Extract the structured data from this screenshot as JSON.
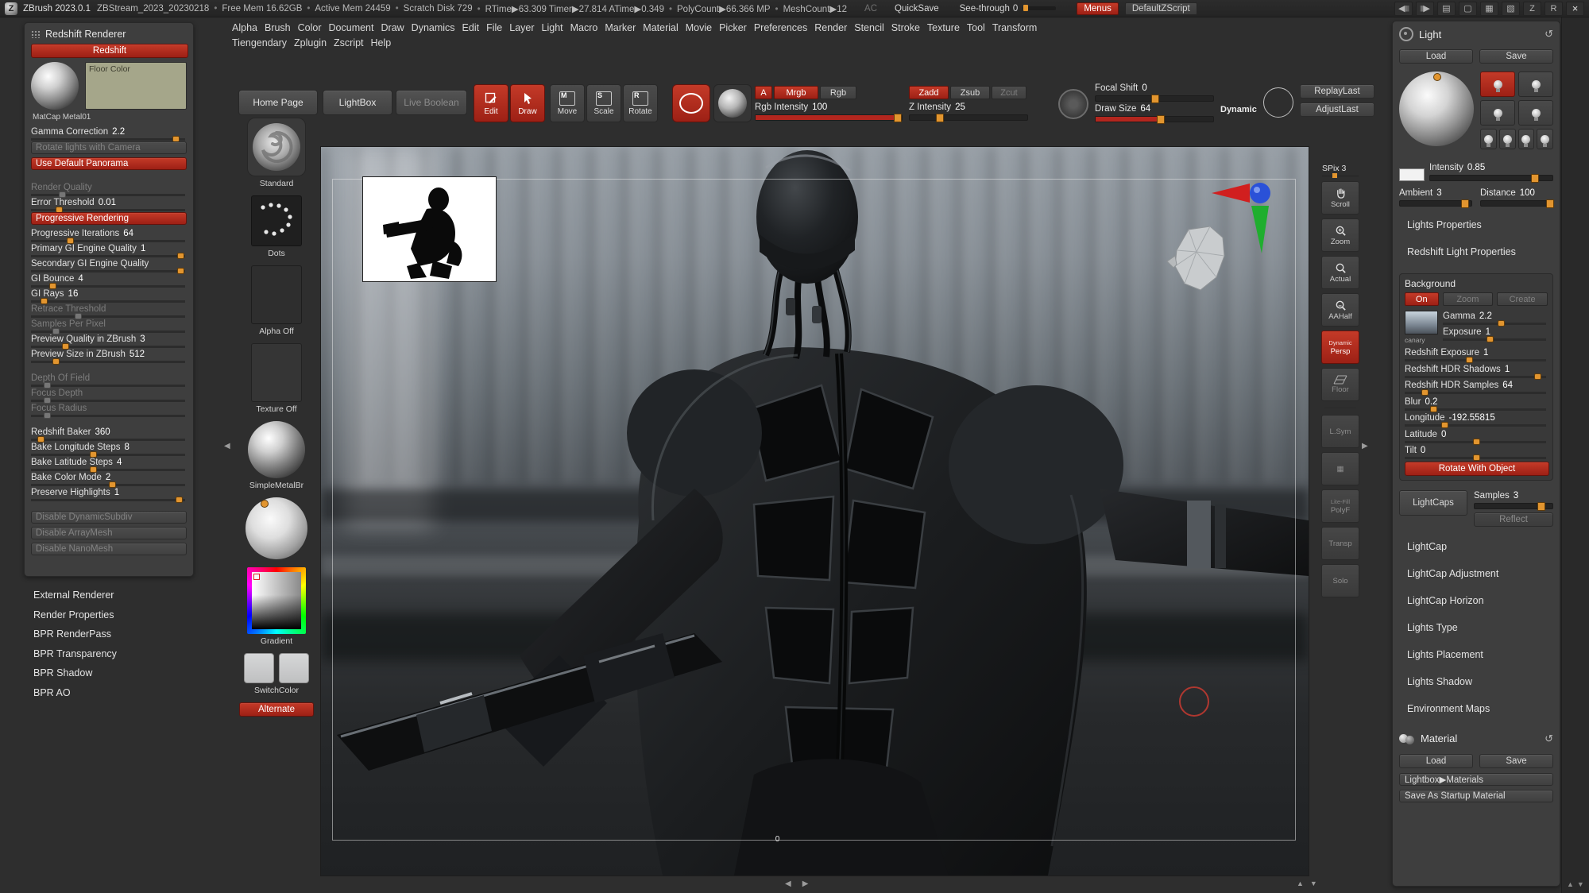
{
  "colors": {
    "accent_red": "#b3261e",
    "accent_orange": "#e2952f",
    "panel_bg": "#3e3e3e",
    "titlebar_bg": "#262626",
    "floor_color": "#a5a68a"
  },
  "icons": {
    "z_logo": "Z",
    "r_logo": "R",
    "close": "×",
    "scroll_left": "◀",
    "scroll_right": "▶",
    "bars": "||||",
    "tablet": "▤",
    "monitor": "▢",
    "grid": "▦",
    "doc": "▧",
    "refresh": "↺",
    "up": "▲",
    "down": "▼"
  },
  "titlebar": {
    "app_title": "ZBrush 2023.0.1",
    "stream": "ZBStream_2023_20230218",
    "stats": [
      "Free Mem 16.62GB",
      "Active Mem 24459",
      "Scratch Disk 729",
      "RTime▶63.309  Timer▶27.814  ATime▶0.349",
      "PolyCount▶66.366 MP",
      "MeshCount▶12"
    ],
    "ac": "AC",
    "quicksave": "QuickSave",
    "see_through": {
      "label": "See-through",
      "value": "0",
      "dot": 8
    },
    "menus": "Menus",
    "default_zscript": "DefaultZScript"
  },
  "menubar": {
    "row1": [
      "Alpha",
      "Brush",
      "Color",
      "Document",
      "Draw",
      "Dynamics",
      "Edit",
      "File",
      "Layer",
      "Light",
      "Macro",
      "Marker",
      "Material",
      "Movie",
      "Picker",
      "Preferences",
      "Render",
      "Stencil",
      "Stroke",
      "Texture",
      "Tool",
      "Transform"
    ],
    "row2": [
      "Tiengendary",
      "Zplugin",
      "Zscript",
      "Help"
    ]
  },
  "toolbar": {
    "home_page": "Home Page",
    "lightbox": "LightBox",
    "live_boolean": "Live Boolean",
    "edit": "Edit",
    "draw": "Draw",
    "move": "Move",
    "scale": "Scale",
    "rotate": "Rotate",
    "badges": {
      "move": "M",
      "scale": "S",
      "rotate": "R"
    },
    "paint_a": "A",
    "paint_mrgb": "Mrgb",
    "paint_rgb": "Rgb",
    "rgb_intensity": {
      "label": "Rgb Intensity",
      "value": "100",
      "fill": 100,
      "dot": 97
    },
    "zadd": "Zadd",
    "zsub": "Zsub",
    "zcut": "Zcut",
    "z_intensity": {
      "label": "Z Intensity",
      "value": "25",
      "fill": 0,
      "dot": 25
    },
    "focal_shift": {
      "label": "Focal Shift",
      "value": "0",
      "fill": 0,
      "dot": 50
    },
    "draw_size": {
      "label": "Draw Size",
      "value": "64",
      "fill": 55,
      "dot": 55
    },
    "dynamic": "Dynamic",
    "replay_last": "ReplayLast",
    "adjust_last": "AdjustLast"
  },
  "left_panel": {
    "title": "Redshift Renderer",
    "redshift_button": "Redshift",
    "matcap_label": "MatCap Metal01",
    "floor_color_label": "Floor Color",
    "items": [
      {
        "t": "slider",
        "label": "Gamma Correction",
        "value": "2.2",
        "dot": 93
      },
      {
        "t": "button",
        "label": "Rotate lights with Camera",
        "state": "dim"
      },
      {
        "t": "button",
        "label": "Use Default Panorama",
        "state": "on"
      },
      {
        "t": "gap"
      },
      {
        "t": "slider",
        "label": "Render Quality",
        "value": "",
        "state": "dim",
        "dot": 20
      },
      {
        "t": "slider",
        "label": "Error Threshold",
        "value": "0.01",
        "dot": 18
      },
      {
        "t": "button",
        "label": "Progressive Rendering",
        "state": "on"
      },
      {
        "t": "slider",
        "label": "Progressive Iterations",
        "value": "64",
        "dot": 25
      },
      {
        "t": "slider",
        "label": "Primary GI Engine Quality",
        "value": "1",
        "dot": 96
      },
      {
        "t": "slider",
        "label": "Secondary GI Engine Quality",
        "value": "",
        "dot": 96
      },
      {
        "t": "slider",
        "label": "GI Bounce",
        "value": "4",
        "dot": 14
      },
      {
        "t": "slider",
        "label": "GI Rays",
        "value": "16",
        "dot": 8
      },
      {
        "t": "slider",
        "label": "Retrace Threshold",
        "value": "",
        "state": "dim",
        "dot": 30
      },
      {
        "t": "slider",
        "label": "Samples Per Pixel",
        "value": "",
        "state": "dim",
        "dot": 16
      },
      {
        "t": "slider",
        "label": "Preview Quality in ZBrush",
        "value": "3",
        "dot": 22
      },
      {
        "t": "slider",
        "label": "Preview Size in ZBrush",
        "value": "512",
        "dot": 16
      },
      {
        "t": "gap"
      },
      {
        "t": "slider",
        "label": "Depth Of Field",
        "value": "",
        "state": "dim",
        "dot": 10
      },
      {
        "t": "slider",
        "label": "Focus Depth",
        "value": "",
        "state": "dim",
        "dot": 10
      },
      {
        "t": "slider",
        "label": "Focus Radius",
        "value": "",
        "state": "dim",
        "dot": 10
      },
      {
        "t": "gap"
      },
      {
        "t": "slider",
        "label": "Redshift Baker",
        "value": "360",
        "dot": 6
      },
      {
        "t": "slider",
        "label": "Bake Longitude Steps",
        "value": "8",
        "dot": 40
      },
      {
        "t": "slider",
        "label": "Bake Latitude Steps",
        "value": "4",
        "dot": 40
      },
      {
        "t": "slider",
        "label": "Bake Color Mode",
        "value": "2",
        "dot": 52
      },
      {
        "t": "slider",
        "label": "Preserve Highlights",
        "value": "1",
        "dot": 95
      },
      {
        "t": "gap"
      },
      {
        "t": "button",
        "label": "Disable DynamicSubdiv",
        "state": "dim"
      },
      {
        "t": "button",
        "label": "Disable ArrayMesh",
        "state": "dim"
      },
      {
        "t": "button",
        "label": "Disable NanoMesh",
        "state": "dim"
      }
    ]
  },
  "left_sections": [
    "External Renderer",
    "Render Properties",
    "BPR RenderPass",
    "BPR Transparency",
    "BPR Shadow",
    "BPR AO"
  ],
  "tool_shelf": {
    "brush": "Standard",
    "stroke": "Dots",
    "alpha": "Alpha Off",
    "texture": "Texture Off",
    "material": "SimpleMetalBr",
    "gradient": "Gradient",
    "switch_color": "SwitchColor",
    "alternate": "Alternate"
  },
  "canvas": {
    "floor_label": "0"
  },
  "right_strip": {
    "spix": {
      "label": "SPix",
      "value": "3",
      "dot": 35
    },
    "scroll": "Scroll",
    "zoom": "Zoom",
    "actual": "Actual",
    "aahalf": "AAHalf",
    "persp_small": "Dynamic",
    "persp": "Persp",
    "floor": "Floor",
    "lsym": "L.Sym",
    "litefill": "Lite-Fill",
    "polyf": "PolyF",
    "transp": "Transp",
    "solo": "Solo"
  },
  "light_panel": {
    "title": "Light",
    "load": "Load",
    "save": "Save",
    "intensity": {
      "label": "Intensity",
      "value": "0.85",
      "dot": 85
    },
    "ambient": {
      "label": "Ambient",
      "value": "3",
      "dot": 90
    },
    "distance": {
      "label": "Distance",
      "value": "100",
      "dot": 95
    },
    "sections_top": [
      "Lights Properties",
      "Redshift Light Properties"
    ],
    "background": {
      "title": "Background",
      "on": "On",
      "zoom": "Zoom",
      "create": "Create",
      "thumb_label": "canary",
      "thumb_sliders": [
        {
          "t": "slider",
          "label": "Gamma",
          "value": "2.2",
          "dot": 55
        },
        {
          "t": "slider",
          "label": "Exposure",
          "value": "1",
          "dot": 45
        }
      ],
      "sliders": [
        {
          "t": "slider",
          "label": "Redshift Exposure",
          "value": "1",
          "dot": 45
        },
        {
          "t": "slider",
          "label": "Redshift HDR Shadows",
          "value": "1",
          "dot": 93
        },
        {
          "t": "slider",
          "label": "Redshift HDR Samples",
          "value": "64",
          "dot": 14
        },
        {
          "t": "slider",
          "label": "Blur",
          "value": "0.2",
          "dot": 20
        },
        {
          "t": "slider",
          "label": "Longitude",
          "value": "-192.55815",
          "dot": 28
        },
        {
          "t": "slider",
          "label": "Latitude",
          "value": "0",
          "dot": 50
        },
        {
          "t": "slider",
          "label": "Tilt",
          "value": "0",
          "dot": 50
        }
      ],
      "rotate_with_object": "Rotate With Object"
    },
    "lightcaps": "LightCaps",
    "samples": {
      "label": "Samples",
      "value": "3",
      "dot": 85
    },
    "reflect": "Reflect",
    "sections": [
      "LightCap",
      "LightCap Adjustment",
      "LightCap Horizon",
      "Lights Type",
      "Lights Placement",
      "Lights Shadow",
      "Environment Maps"
    ]
  },
  "material_panel": {
    "title": "Material",
    "load": "Load",
    "save": "Save",
    "lightbox_materials": "Lightbox▶Materials",
    "save_startup": "Save As Startup Material"
  }
}
